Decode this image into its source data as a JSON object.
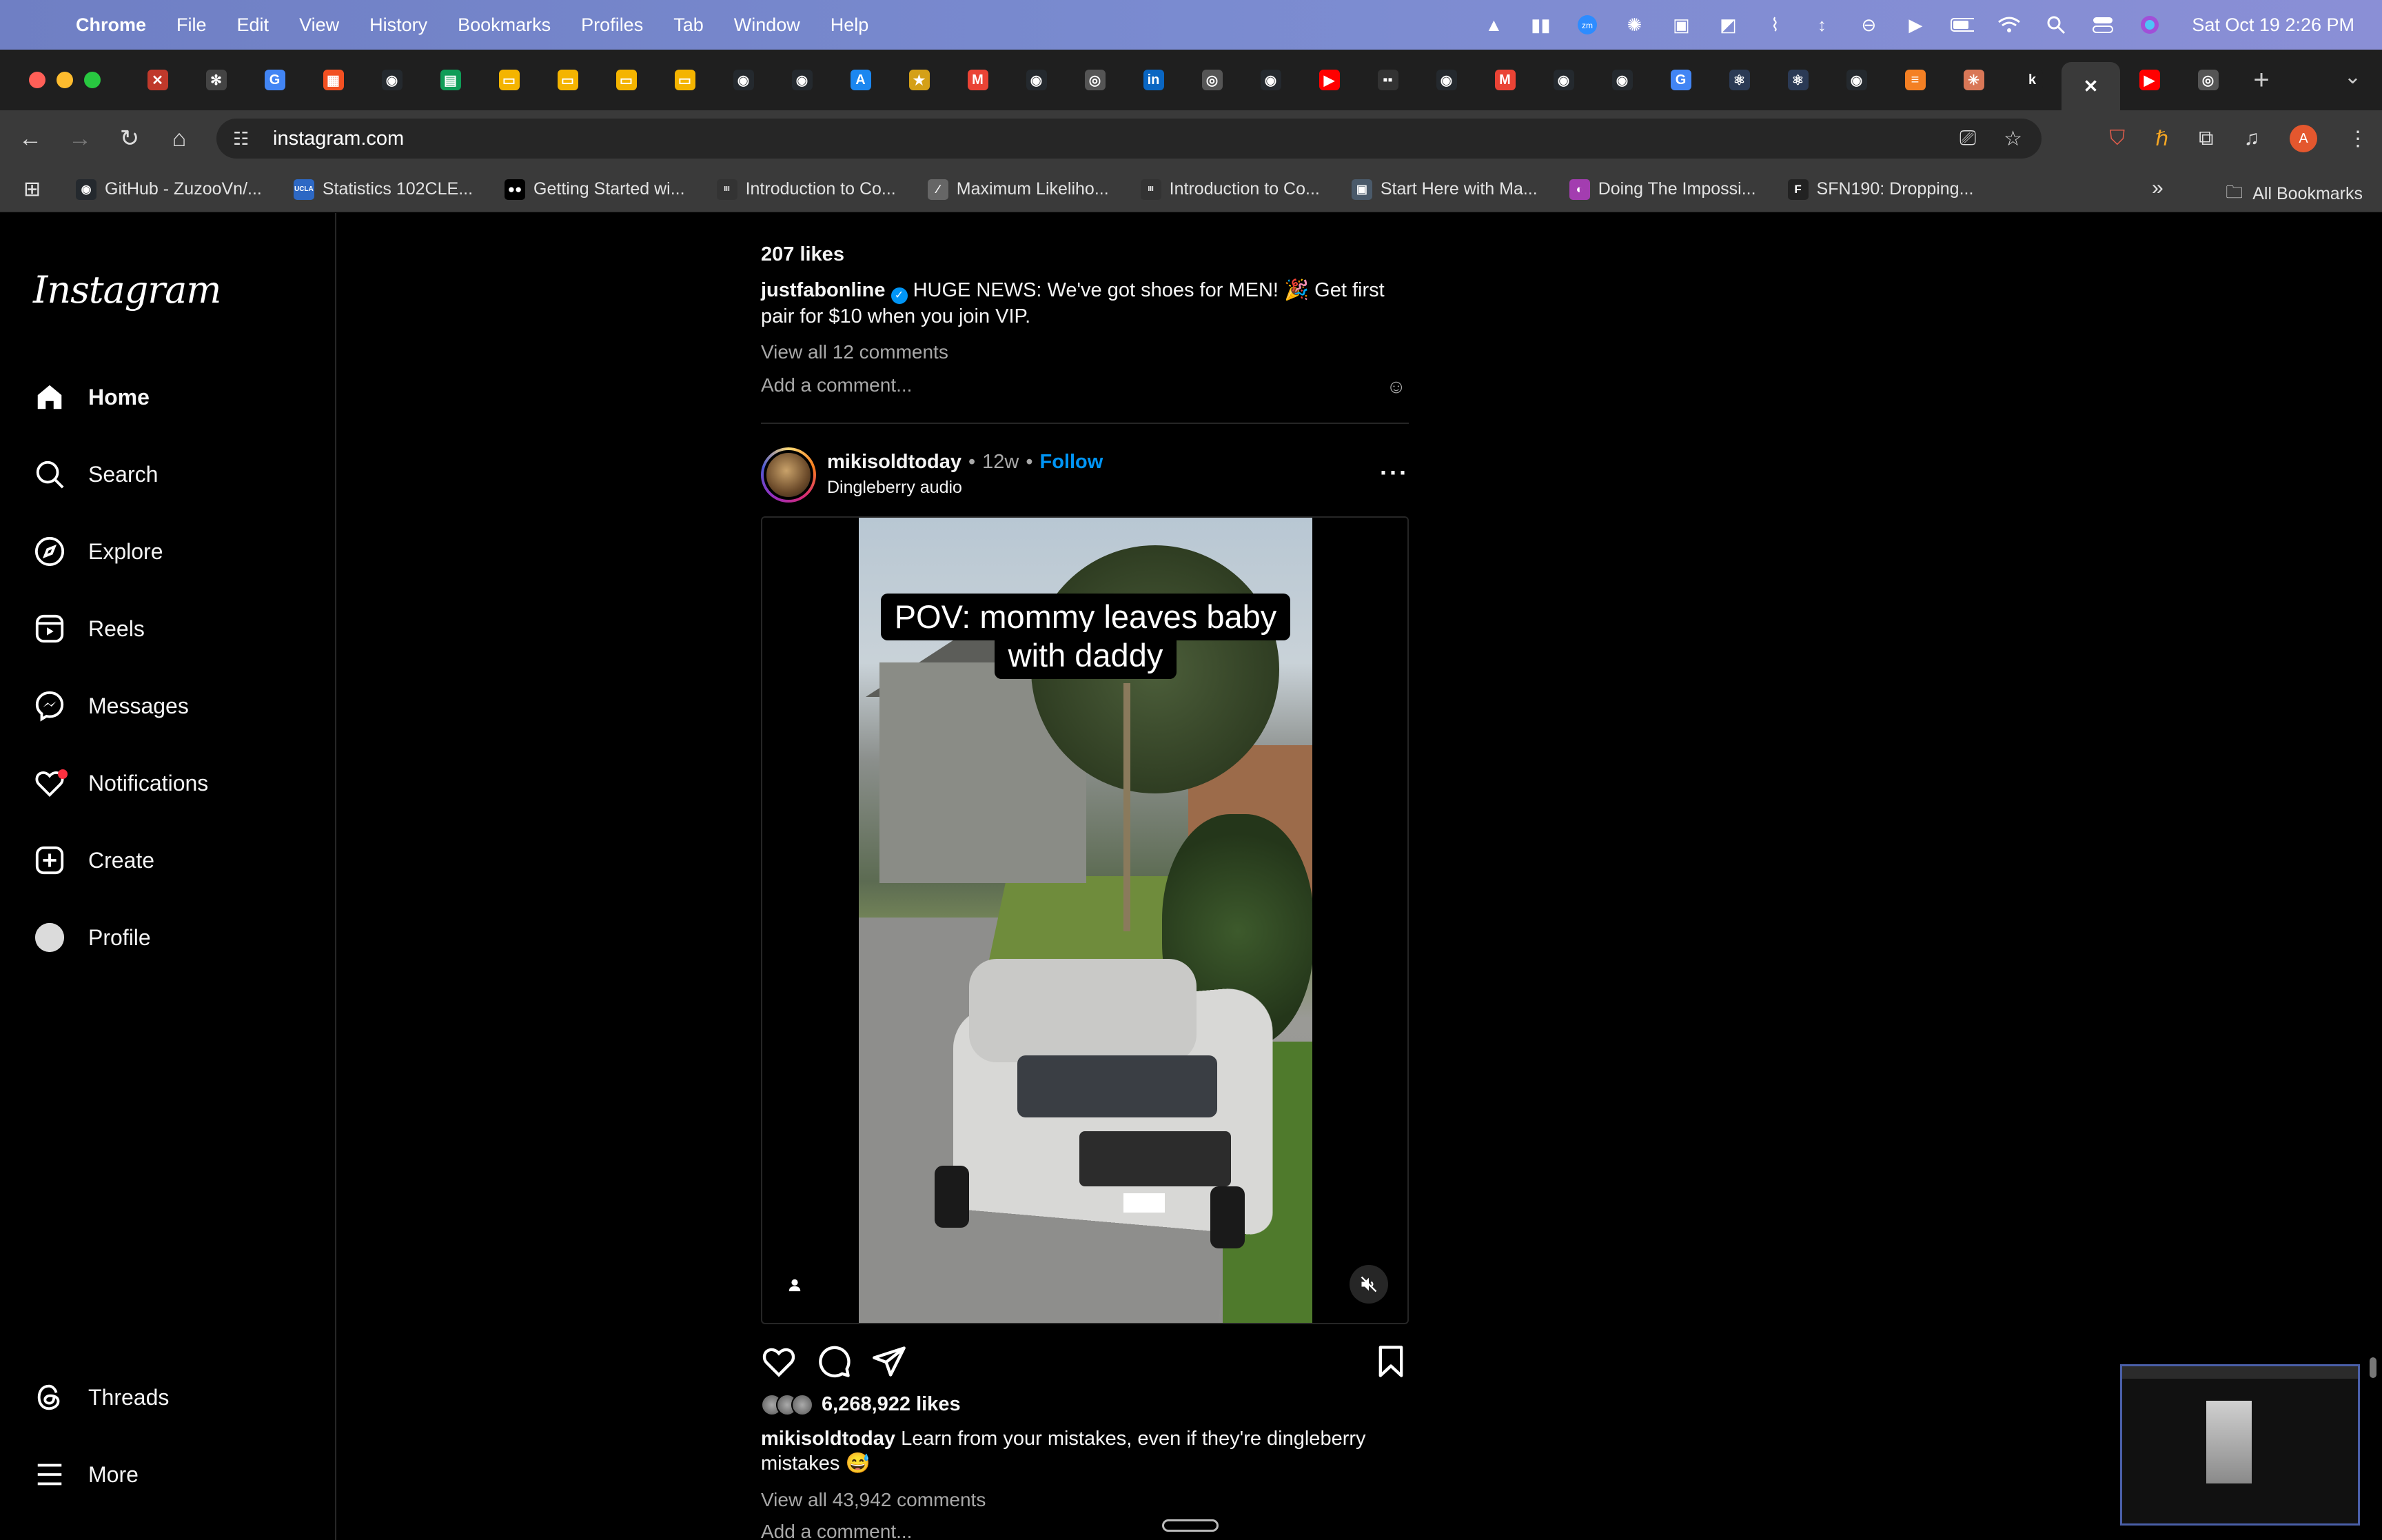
{
  "menubar": {
    "app_name": "Chrome",
    "menus": [
      "File",
      "Edit",
      "View",
      "History",
      "Bookmarks",
      "Profiles",
      "Tab",
      "Window",
      "Help"
    ],
    "clock": "Sat Oct 19  2:26 PM"
  },
  "tabs": {
    "favicons": [
      {
        "icon": "x-close-icon",
        "color": "#c0392b",
        "glyph": "✕"
      },
      {
        "icon": "bug-icon",
        "color": "#444444",
        "glyph": "✻"
      },
      {
        "icon": "google-icon",
        "color": "#4285f4",
        "glyph": "G"
      },
      {
        "icon": "microsoft-icon",
        "color": "#f25022",
        "glyph": "▦"
      },
      {
        "icon": "github-icon",
        "color": "#24292e",
        "glyph": "◉"
      },
      {
        "icon": "sheets-icon",
        "color": "#0f9d58",
        "glyph": "▤"
      },
      {
        "icon": "slides-icon",
        "color": "#f4b400",
        "glyph": "▭"
      },
      {
        "icon": "slides-icon",
        "color": "#f4b400",
        "glyph": "▭"
      },
      {
        "icon": "slides-icon",
        "color": "#f4b400",
        "glyph": "▭"
      },
      {
        "icon": "slides-icon",
        "color": "#f4b400",
        "glyph": "▭"
      },
      {
        "icon": "github-icon",
        "color": "#24292e",
        "glyph": "◉"
      },
      {
        "icon": "github-icon",
        "color": "#24292e",
        "glyph": "◉"
      },
      {
        "icon": "app-store-icon",
        "color": "#1b87f0",
        "glyph": "A"
      },
      {
        "icon": "badge-icon",
        "color": "#d4a017",
        "glyph": "★"
      },
      {
        "icon": "gmail-icon",
        "color": "#ea4335",
        "glyph": "M"
      },
      {
        "icon": "github-icon",
        "color": "#24292e",
        "glyph": "◉"
      },
      {
        "icon": "chrome-icon",
        "color": "#555555",
        "glyph": "◎"
      },
      {
        "icon": "linkedin-icon",
        "color": "#0a66c2",
        "glyph": "in"
      },
      {
        "icon": "chrome-icon",
        "color": "#555555",
        "glyph": "◎"
      },
      {
        "icon": "github-icon",
        "color": "#24292e",
        "glyph": "◉"
      },
      {
        "icon": "youtube-icon",
        "color": "#ff0000",
        "glyph": "▶"
      },
      {
        "icon": "grid-icon",
        "color": "#333333",
        "glyph": "▪▪"
      },
      {
        "icon": "github-icon",
        "color": "#24292e",
        "glyph": "◉"
      },
      {
        "icon": "gmail-icon",
        "color": "#ea4335",
        "glyph": "M"
      },
      {
        "icon": "github-icon",
        "color": "#24292e",
        "glyph": "◉"
      },
      {
        "icon": "github-icon",
        "color": "#24292e",
        "glyph": "◉"
      },
      {
        "icon": "google-icon",
        "color": "#4285f4",
        "glyph": "G"
      },
      {
        "icon": "react-icon",
        "color": "#2b3a55",
        "glyph": "⚛"
      },
      {
        "icon": "react-icon",
        "color": "#2b3a55",
        "glyph": "⚛"
      },
      {
        "icon": "github-icon",
        "color": "#24292e",
        "glyph": "◉"
      },
      {
        "icon": "stack-icon",
        "color": "#f48024",
        "glyph": "≡"
      },
      {
        "icon": "claude-icon",
        "color": "#d97757",
        "glyph": "✳"
      },
      {
        "icon": "k-icon",
        "color": "#1f1f1f",
        "glyph": "k"
      },
      {
        "icon": "close-tab-icon",
        "color": "#3a3a3a",
        "glyph": "✕",
        "active": true
      },
      {
        "icon": "youtube-icon",
        "color": "#ff0000",
        "glyph": "▶"
      },
      {
        "icon": "chrome-icon",
        "color": "#555555",
        "glyph": "◎"
      }
    ]
  },
  "toolbar": {
    "url": "instagram.com"
  },
  "bookmarks": [
    {
      "label": "GitHub - ZuzooVn/...",
      "icon": "github-icon",
      "color": "#24292e",
      "glyph": "◉"
    },
    {
      "label": "Statistics 102CLE...",
      "icon": "ucla-icon",
      "color": "#2d68c4",
      "glyph": "UCLA"
    },
    {
      "label": "Getting Started wi...",
      "icon": "medium-icon",
      "color": "#000000",
      "glyph": "●●"
    },
    {
      "label": "Introduction to Co...",
      "icon": "course-icon",
      "color": "#333333",
      "glyph": "III"
    },
    {
      "label": "Maximum Likeliho...",
      "icon": "chart-icon",
      "color": "#666666",
      "glyph": "∕"
    },
    {
      "label": "Introduction to Co...",
      "icon": "course-icon",
      "color": "#333333",
      "glyph": "III"
    },
    {
      "label": "Start Here with Ma...",
      "icon": "book-icon",
      "color": "#4a5a6a",
      "glyph": "▣"
    },
    {
      "label": "Doing The Impossi...",
      "icon": "podcast-icon",
      "color": "#a33db0",
      "glyph": "◐"
    },
    {
      "label": "SFN190: Dropping...",
      "icon": "f-icon",
      "color": "#222222",
      "glyph": "F"
    }
  ],
  "bookmarks_all": "All Bookmarks",
  "instagram": {
    "logo": "Instagram",
    "nav": [
      {
        "label": "Home",
        "icon": "home-icon"
      },
      {
        "label": "Search",
        "icon": "search-icon"
      },
      {
        "label": "Explore",
        "icon": "compass-icon"
      },
      {
        "label": "Reels",
        "icon": "reels-icon"
      },
      {
        "label": "Messages",
        "icon": "messenger-icon"
      },
      {
        "label": "Notifications",
        "icon": "heart-icon"
      },
      {
        "label": "Create",
        "icon": "plus-square-icon"
      },
      {
        "label": "Profile",
        "icon": "profile-avatar-icon"
      }
    ],
    "threads": "Threads",
    "more": "More",
    "prev_post": {
      "likes": "207 likes",
      "username": "justfabonline",
      "caption": "HUGE NEWS: We've got shoes for MEN! 🎉 Get first pair for $10 when you join VIP.",
      "view_comments": "View all 12 comments",
      "add_comment": "Add a comment..."
    },
    "post": {
      "username": "mikisoldtoday",
      "age": "12w",
      "follow": "Follow",
      "audio": "Dingleberry audio",
      "overlay_line1": "POV: mommy leaves baby",
      "overlay_line2": "with daddy",
      "likes": "6,268,922 likes",
      "caption": "Learn from your mistakes, even if they're dingleberry mistakes 😅",
      "view_comments": "View all 43,942 comments",
      "add_comment": "Add a comment..."
    }
  }
}
